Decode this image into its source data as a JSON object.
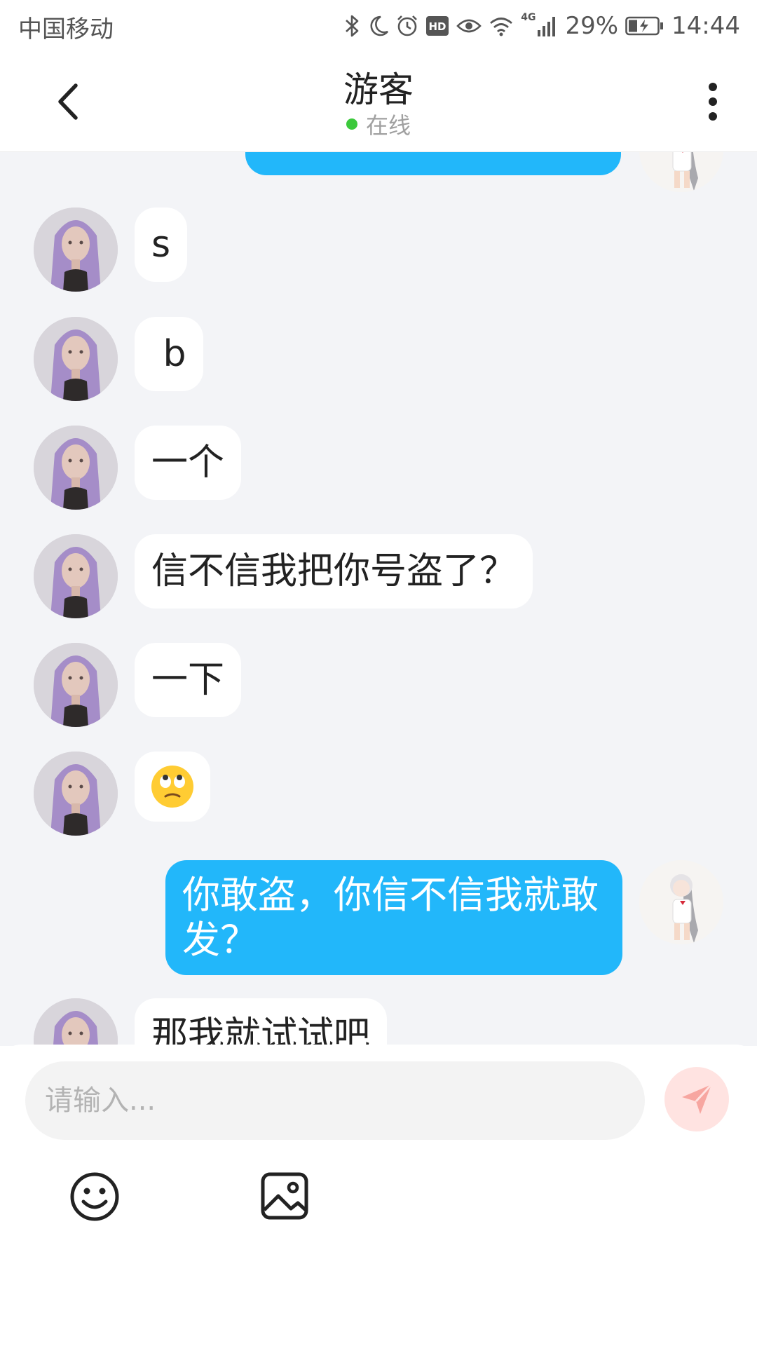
{
  "status_bar": {
    "carrier": "中国移动",
    "network_type": "4G",
    "battery_percent": "29%",
    "time": "14:44",
    "icons": [
      "bluetooth-icon",
      "moon-icon",
      "alarm-icon",
      "hd-icon",
      "eye-icon",
      "wifi-icon",
      "signal-icon",
      "battery-charging-icon"
    ]
  },
  "header": {
    "title": "游客",
    "status": "在线",
    "status_color": "#3cc93c",
    "back_icon": "chevron-left-icon",
    "menu_icon": "more-vertical-icon"
  },
  "messages": [
    {
      "side": "right",
      "text": "",
      "partial": true
    },
    {
      "side": "left",
      "text": "s"
    },
    {
      "side": "left",
      "text": " b"
    },
    {
      "side": "left",
      "text": "一个"
    },
    {
      "side": "left",
      "text": "信不信我把你号盗了？"
    },
    {
      "side": "left",
      "text": "一下"
    },
    {
      "side": "left",
      "emoji": "eye-roll-emoji"
    },
    {
      "side": "right",
      "text": "你敢盗，你信不信我就敢发？"
    },
    {
      "side": "left",
      "text": "那我就试试吧"
    }
  ],
  "input": {
    "placeholder": "请输入...",
    "value": ""
  },
  "colors": {
    "accent_blue": "#22b7fa",
    "send_button_bg": "#ffe3e1",
    "send_icon": "#f7a6a0",
    "chat_background": "#f3f4f7"
  },
  "toolbar": {
    "send_icon": "send-icon",
    "emoji_icon": "smiley-icon",
    "image_icon": "image-icon"
  }
}
